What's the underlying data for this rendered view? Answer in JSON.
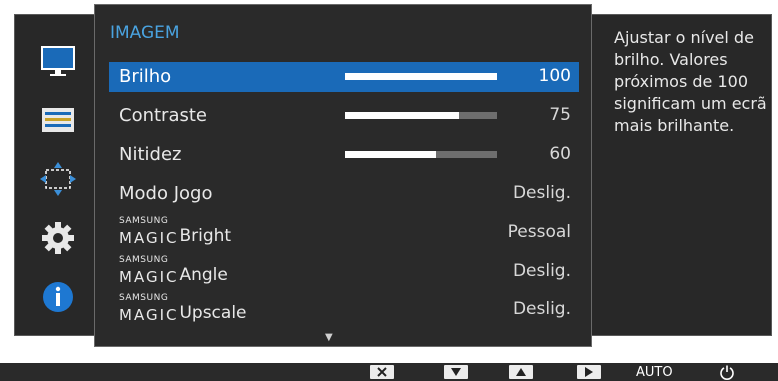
{
  "menu": {
    "title": "IMAGEM",
    "items": [
      {
        "label": "Brilho",
        "value": "100",
        "level": 1.0,
        "selected": true
      },
      {
        "label": "Contraste",
        "value": "75",
        "level": 0.75
      },
      {
        "label": "Nitidez",
        "value": "60",
        "level": 0.6
      },
      {
        "label": "Modo Jogo",
        "value": "Deslig."
      },
      {
        "brand_small": "SAMSUNG",
        "brand_large": "MAGIC",
        "label": "Bright",
        "value": "Pessoal"
      },
      {
        "brand_small": "SAMSUNG",
        "brand_large": "MAGIC",
        "label": "Angle",
        "value": "Deslig."
      },
      {
        "brand_small": "SAMSUNG",
        "brand_large": "MAGIC",
        "label": "Upscale",
        "value": "Deslig."
      }
    ]
  },
  "sidebar": {
    "icons": [
      "monitor-icon",
      "settings-list-icon",
      "resize-arrows-icon",
      "gear-icon",
      "info-icon"
    ]
  },
  "description": "Ajustar o nível de brilho. Valores próximos de 100 significam um ecrã mais brilhante.",
  "bottom_bar": {
    "buttons": [
      "close-icon",
      "arrow-down-icon",
      "arrow-up-icon",
      "arrow-right-icon"
    ],
    "auto_label": "AUTO",
    "power_icon": "power-icon"
  },
  "colors": {
    "accent": "#1a6ab8",
    "title": "#4aa3e0",
    "panel": "#2a2a2a"
  }
}
